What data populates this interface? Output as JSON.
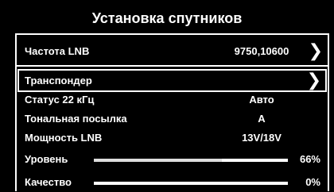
{
  "screen": {
    "title": "Установка спутников"
  },
  "menu": {
    "lnb_frequency": {
      "label": "Частота LNB",
      "value": "9750,10600"
    },
    "transponder": {
      "label": "Транспондер"
    },
    "status_22khz": {
      "label": "Статус 22 кГц",
      "value": "Авто"
    },
    "tone_burst": {
      "label": "Тональная посылка",
      "value": "A"
    },
    "lnb_power": {
      "label": "Мощность LNB",
      "value": "13V/18V"
    }
  },
  "signal": {
    "level": {
      "label": "Уровень",
      "percent_text": "66%",
      "fraction": 0.66
    },
    "quality": {
      "label": "Качество",
      "percent_text": "0%",
      "fraction": 0.0
    }
  },
  "icons": {
    "chevron": "chevron-right-icon"
  }
}
